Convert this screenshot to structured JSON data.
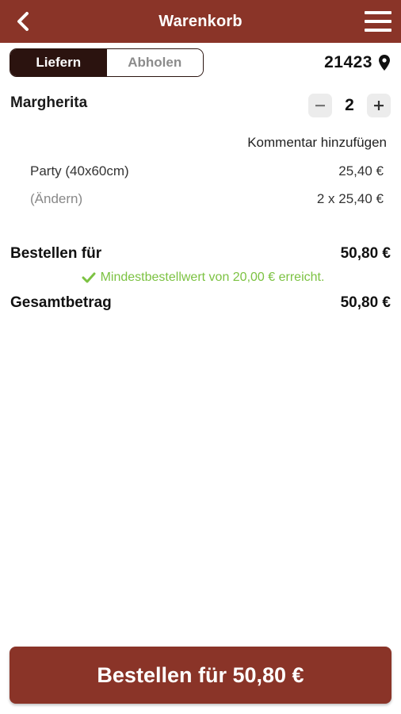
{
  "header": {
    "title": "Warenkorb",
    "background_color": "#8a3428",
    "back_icon": "chevron-left-icon",
    "menu_icon": "hamburger-menu-icon"
  },
  "delivery_toggle": {
    "options": [
      "Liefern",
      "Abholen"
    ],
    "selected": "Liefern"
  },
  "location": {
    "postal_code": "21423",
    "icon": "map-pin-icon"
  },
  "cart": {
    "items": [
      {
        "name": "Margherita",
        "quantity": "2",
        "comment_link": "Kommentar hinzufügen",
        "size": "Party (40x60cm)",
        "size_price": "25,40 €",
        "change_link": "(Ändern)",
        "line_price": "2 x 25,40 €"
      }
    ]
  },
  "summary": {
    "order_for_label": "Bestellen für",
    "order_for_value": "50,80 €",
    "minimum_message": "Mindestbestellwert von 20,00 € erreicht.",
    "minimum_color": "#7cc242",
    "total_label": "Gesamtbetrag",
    "total_value": "50,80 €"
  },
  "order_button": {
    "label": "Bestellen für 50,80 €",
    "color": "#8a3428"
  }
}
